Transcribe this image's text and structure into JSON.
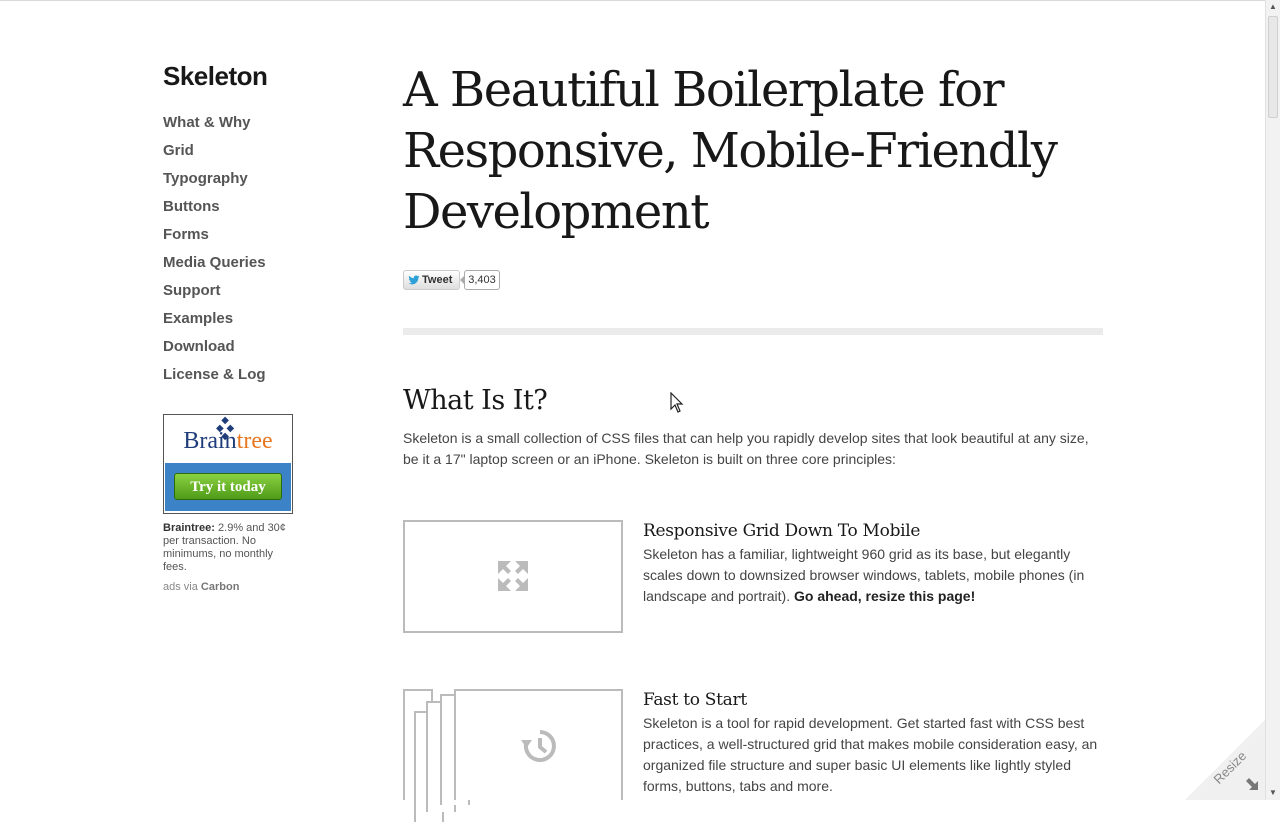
{
  "sidebar": {
    "logo": "Skeleton",
    "nav": [
      "What & Why",
      "Grid",
      "Typography",
      "Buttons",
      "Forms",
      "Media Queries",
      "Support",
      "Examples",
      "Download",
      "License & Log"
    ],
    "ad": {
      "brand_a": "Brain",
      "brand_b": "tree",
      "cta": "Try it today",
      "text_bold": "Braintree:",
      "text": " 2.9% and 30¢ per transaction. No minimums, no monthly fees.",
      "via_prefix": "ads via ",
      "via_link": "Carbon"
    }
  },
  "main": {
    "hero": "A Beautiful Boilerplate for Responsive, Mobile-Friendly Development",
    "tweet_label": "Tweet",
    "tweet_count": "3,403",
    "section_title": "What Is It?",
    "intro": "Skeleton is a small collection of CSS files that can help you rapidly develop sites that look beautiful at any size, be it a 17\" laptop screen or an iPhone. Skeleton is built on three core principles:",
    "features": [
      {
        "title": "Responsive Grid Down To Mobile",
        "text": "Skeleton has a familiar, lightweight 960 grid as its base, but elegantly scales down to downsized browser windows, tablets, mobile phones (in landscape and portrait). ",
        "text_bold": "Go ahead, resize this page!",
        "icon": "expand-icon"
      },
      {
        "title": "Fast to Start",
        "text": "Skeleton is a tool for rapid development. Get started fast with CSS best practices, a well-structured grid that makes mobile consideration easy, an organized file structure and super basic UI elements like lightly styled forms, buttons, tabs and more.",
        "icon": "history-icon"
      }
    ]
  },
  "resize_label": "Resize",
  "colors": {
    "text": "#444444",
    "heading": "#181818",
    "rule": "#ebebeb",
    "ad_blue": "#3b82c6",
    "ad_green": "#6db52c",
    "ad_orange": "#e87722"
  }
}
